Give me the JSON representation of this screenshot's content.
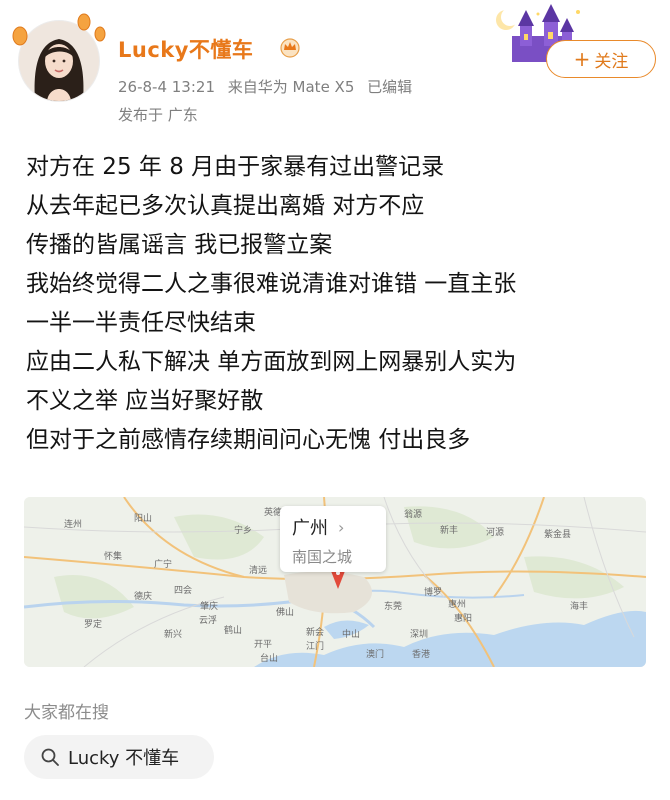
{
  "user": {
    "name": "Lucky不懂车",
    "date": "26-8-4 13:21",
    "source": "来自华为 Mate X5",
    "edited": "已编辑",
    "location": "发布于 广东"
  },
  "follow": {
    "plus": "+",
    "label": "关注"
  },
  "post": {
    "lines": [
      "对方在 25 年 8 月由于家暴有过出警记录",
      "从去年起已多次认真提出离婚 对方不应",
      "传播的皆属谣言 我已报警立案",
      "我始终觉得二人之事很难说清谁对谁错 一直主张",
      "一半一半责任尽快结束",
      "应由二人私下解决 单方面放到网上网暴别人实为",
      "不义之举 应当好聚好散",
      "但对于之前感情存续期间问心无愧 付出良多"
    ]
  },
  "map": {
    "city": "广州",
    "subtitle": "南国之城",
    "place_labels": [
      "阳山",
      "连州",
      "清远",
      "英德",
      "翁源",
      "新丰",
      "河源",
      "紫金县",
      "宁乡",
      "四会",
      "广宁",
      "怀集",
      "德庆",
      "肇庆",
      "云浮",
      "佛山",
      "东莞",
      "惠州",
      "惠阳",
      "江门",
      "中山",
      "开平",
      "台山",
      "新会",
      "深圳",
      "香港",
      "澳门",
      "博罗",
      "海丰",
      "罗定",
      "新兴",
      "鹤山"
    ]
  },
  "search": {
    "title": "大家都在搜",
    "query": "Lucky 不懂车"
  },
  "colors": {
    "username": "#e8781a",
    "follow_border": "#e98a2b",
    "meta_gray": "#7f7f7f"
  }
}
